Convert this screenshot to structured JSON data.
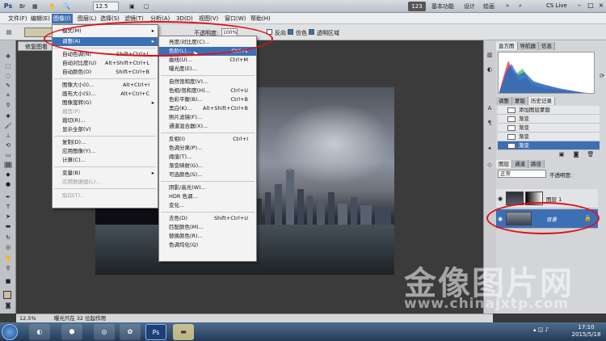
{
  "titlebar": {
    "app_logo": "Ps",
    "zoom": "12.5",
    "workspace_badge": "123",
    "workspaces": [
      "基本功能",
      "设计",
      "绘画"
    ],
    "cs_live": "CS Live"
  },
  "menubar": {
    "items": [
      "文件(F)",
      "编辑(E)",
      "图像(I)",
      "图层(L)",
      "选择(S)",
      "滤镜(T)",
      "分析(A)",
      "3D(D)",
      "视图(V)",
      "窗口(W)",
      "帮助(H)"
    ],
    "active_index": 2
  },
  "optionsbar": {
    "opacity_label": "不透明度:",
    "opacity_value": "100%",
    "reverse_label": "反向",
    "dither_label": "仿色",
    "transparency_label": "透明区域"
  },
  "document": {
    "tab_label": "修复图看"
  },
  "image_menu": {
    "items": [
      {
        "label": "模式(M)",
        "shortcut": "",
        "arrow": true,
        "disabled": false
      },
      {
        "label": "调整(A)",
        "shortcut": "",
        "arrow": true,
        "disabled": false,
        "highlight": true
      },
      {
        "label": "自动色调(N)",
        "shortcut": "Shift+Ctrl+L",
        "disabled": false
      },
      {
        "label": "自动对比度(U)",
        "shortcut": "Alt+Shift+Ctrl+L",
        "disabled": false
      },
      {
        "label": "自动颜色(O)",
        "shortcut": "Shift+Ctrl+B",
        "disabled": false
      },
      {
        "label": "图像大小(I)...",
        "shortcut": "Alt+Ctrl+I",
        "disabled": false
      },
      {
        "label": "画布大小(S)...",
        "shortcut": "Alt+Ctrl+C",
        "disabled": false
      },
      {
        "label": "图像旋转(G)",
        "shortcut": "",
        "arrow": true,
        "disabled": false
      },
      {
        "label": "裁剪(P)",
        "shortcut": "",
        "disabled": true
      },
      {
        "label": "裁切(R)...",
        "shortcut": "",
        "disabled": false
      },
      {
        "label": "显示全部(V)",
        "shortcut": "",
        "disabled": false
      },
      {
        "label": "复制(D)...",
        "shortcut": "",
        "disabled": false
      },
      {
        "label": "应用图像(Y)...",
        "shortcut": "",
        "disabled": false
      },
      {
        "label": "计算(C)...",
        "shortcut": "",
        "disabled": false
      },
      {
        "label": "变量(B)",
        "shortcut": "",
        "arrow": true,
        "disabled": false
      },
      {
        "label": "应用数据组(L)...",
        "shortcut": "",
        "disabled": true
      },
      {
        "label": "陷印(T)...",
        "shortcut": "",
        "disabled": true
      }
    ]
  },
  "adjust_submenu": {
    "items": [
      {
        "label": "亮度/对比度(C)...",
        "shortcut": ""
      },
      {
        "label": "色阶(L)...",
        "shortcut": "Ctrl+L",
        "highlight": true
      },
      {
        "label": "曲线(U)...",
        "shortcut": "Ctrl+M"
      },
      {
        "label": "曝光度(E)...",
        "shortcut": ""
      },
      {
        "label": "自然饱和度(V)...",
        "shortcut": ""
      },
      {
        "label": "色相/饱和度(H)...",
        "shortcut": "Ctrl+U"
      },
      {
        "label": "色彩平衡(B)...",
        "shortcut": "Ctrl+B"
      },
      {
        "label": "黑白(K)...",
        "shortcut": "Alt+Shift+Ctrl+B"
      },
      {
        "label": "照片滤镜(F)...",
        "shortcut": ""
      },
      {
        "label": "通道混合器(X)...",
        "shortcut": ""
      },
      {
        "label": "反相(I)",
        "shortcut": "Ctrl+I"
      },
      {
        "label": "色调分离(P)...",
        "shortcut": ""
      },
      {
        "label": "阈值(T)...",
        "shortcut": ""
      },
      {
        "label": "渐变映射(G)...",
        "shortcut": ""
      },
      {
        "label": "可选颜色(S)...",
        "shortcut": ""
      },
      {
        "label": "阴影/高光(W)...",
        "shortcut": ""
      },
      {
        "label": "HDR 色调...",
        "shortcut": ""
      },
      {
        "label": "变化...",
        "shortcut": ""
      },
      {
        "label": "去色(D)",
        "shortcut": "Shift+Ctrl+U"
      },
      {
        "label": "匹配颜色(M)...",
        "shortcut": ""
      },
      {
        "label": "替换颜色(R)...",
        "shortcut": ""
      },
      {
        "label": "色调均化(Q)",
        "shortcut": ""
      }
    ]
  },
  "panels": {
    "histogram_tabs": [
      "直方图",
      "导航器",
      "信息"
    ],
    "history_tabs": [
      "调整",
      "蒙版",
      "历史记录"
    ],
    "history_items": [
      "添加图层蒙版",
      "渐变",
      "渐变",
      "渐变",
      "渐变"
    ],
    "layers_tabs": [
      "图层",
      "通道",
      "路径"
    ],
    "blend_mode": "正常",
    "opacity_label": "不透明度:",
    "layers": [
      {
        "name": "图层 1",
        "selected": false
      },
      {
        "name": "背景",
        "selected": true
      }
    ]
  },
  "statusbar": {
    "zoom": "12.5%",
    "info": "曝光只在 32 位起作用"
  },
  "taskbar": {
    "time": "17:10",
    "date": "2015/5/18"
  },
  "watermark": {
    "main": "金像图片网",
    "url": "www.chinajxtp.com"
  }
}
